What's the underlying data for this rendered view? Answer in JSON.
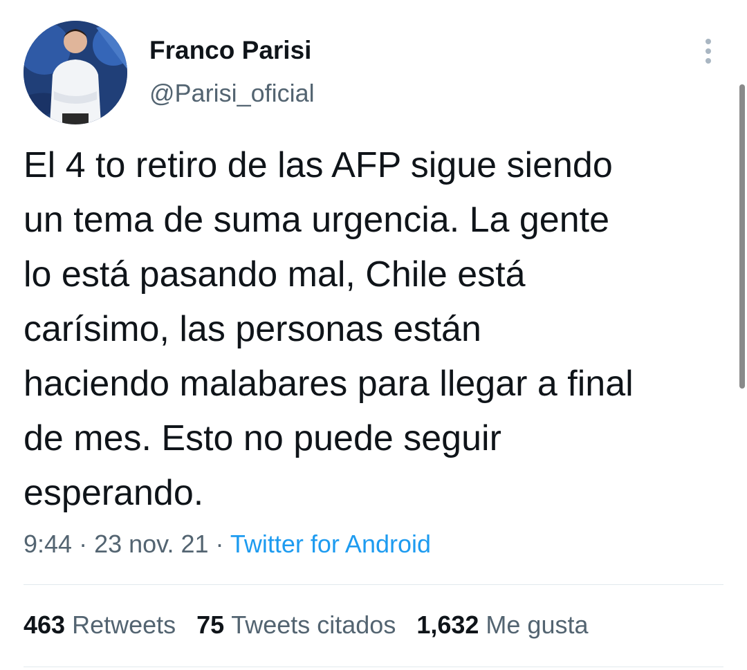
{
  "author": {
    "name": "Franco Parisi",
    "handle": "@Parisi_oficial",
    "avatar_icon": "profile-photo"
  },
  "tweet": {
    "text_lines": [
      "El 4 to retiro de las AFP sigue siendo",
      "un tema de suma urgencia. La gente",
      "lo está pasando mal, Chile está",
      "carísimo, las personas están",
      "haciendo malabares para llegar a final",
      "de mes. Esto no puede seguir",
      "esperando."
    ],
    "time": "9:44",
    "separator": " · ",
    "date": "23 nov. 21",
    "source": "Twitter for Android"
  },
  "stats": {
    "retweets_count": "463",
    "retweets_label": "Retweets",
    "quotes_count": "75",
    "quotes_label": "Tweets citados",
    "likes_count": "1,632",
    "likes_label": "Me gusta"
  },
  "icons": {
    "more": "more-vertical-icon"
  },
  "colors": {
    "text_primary": "#0f1419",
    "text_secondary": "#536471",
    "link": "#1d9bf0",
    "divider": "#e1e8ed"
  }
}
